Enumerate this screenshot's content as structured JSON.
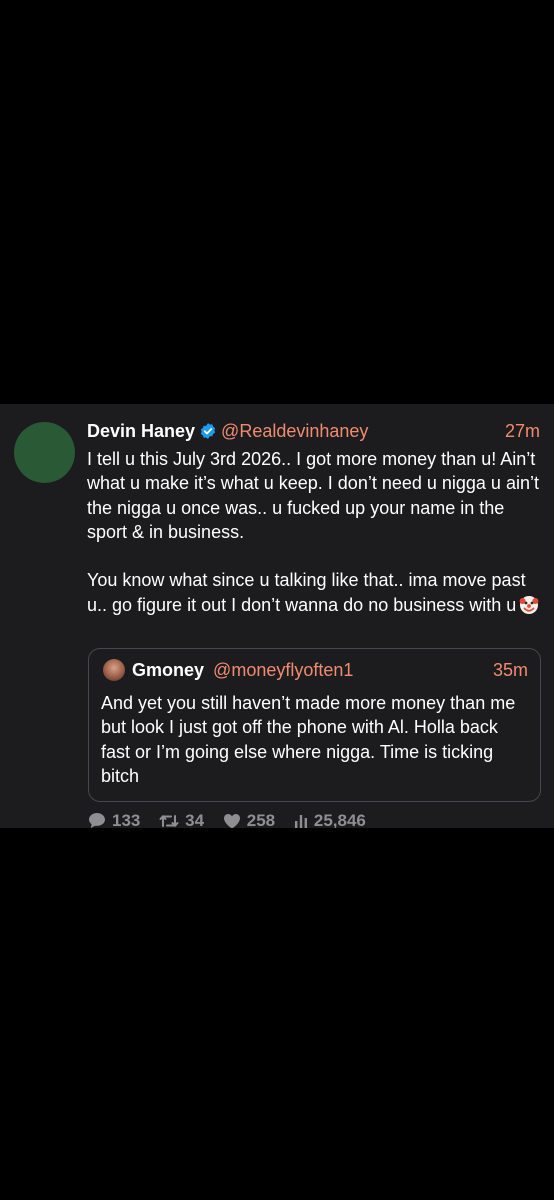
{
  "tweet": {
    "display_name": "Devin Haney",
    "handle": "@Realdevinhaney",
    "time": "27m",
    "paragraph_1": "I tell u this July 3rd 2026.. I got more money than u! Ain’t what u make it’s what u keep. I don’t need u nigga u ain’t the nigga u once was.. u fucked up your name in the sport & in business.",
    "paragraph_2": "You know what since u talking like that.. ima move past u.. go figure it out I don’t wanna do no business with u",
    "emoji": "clown-face-icon"
  },
  "quote": {
    "display_name": "Gmoney",
    "handle": "@moneyflyoften1",
    "time": "35m",
    "text": "And yet you still haven’t made more money than me but look I just got off the phone with Al. Holla back fast or I’m going else where nigga. Time is ticking bitch"
  },
  "actions": {
    "replies": "133",
    "retweets": "34",
    "likes": "258",
    "views": "25,846"
  },
  "colors": {
    "background": "#000000",
    "card": "#1c1c1e",
    "accent": "#f08b72",
    "verified": "#1d9bf0",
    "muted": "#8e8e93"
  }
}
